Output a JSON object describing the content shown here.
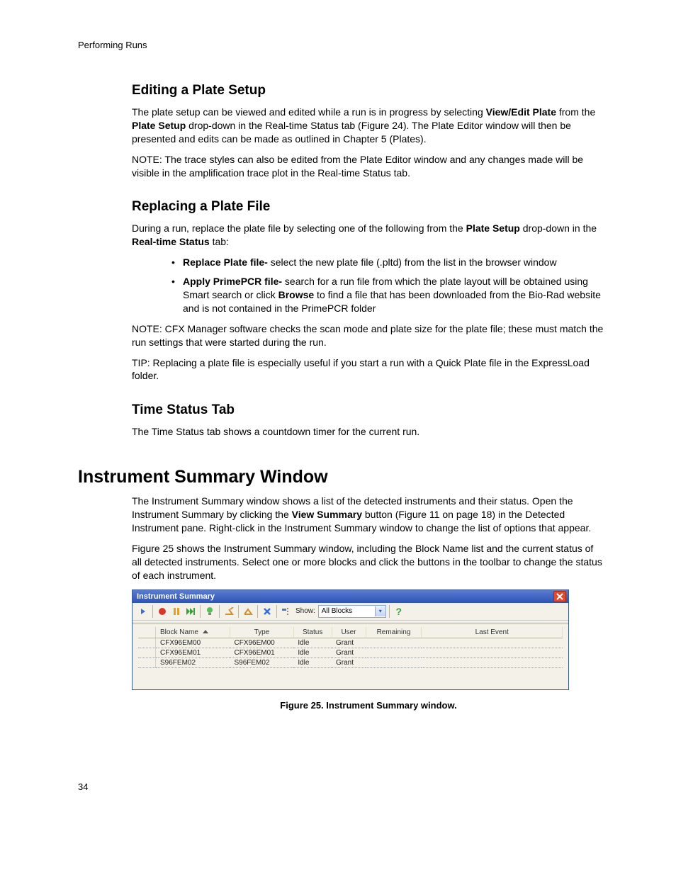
{
  "running_head": "Performing Runs",
  "page_number": "34",
  "sec_editing": {
    "title": "Editing a Plate Setup",
    "p1_a": "The plate setup can be viewed and edited while a run is in progress by selecting ",
    "p1_b": "View/Edit Plate",
    "p1_c": " from the ",
    "p1_d": "Plate Setup",
    "p1_e": " drop-down in the Real-time Status tab (Figure 24). The Plate Editor window will then be presented and edits can be made as outlined in Chapter 5 (Plates).",
    "note": "NOTE: The trace styles can also be edited from the Plate Editor window and any changes made will be visible in the amplification trace plot in the Real-time Status tab."
  },
  "sec_replacing": {
    "title": "Replacing a Plate File",
    "p1_a": "During a run, replace the plate file by selecting one of the following from the ",
    "p1_b": "Plate Setup",
    "p1_c": " drop-down in the ",
    "p1_d": "Real-time Status",
    "p1_e": " tab:",
    "b1_a": "Replace Plate file-",
    "b1_b": " select the new plate file (.pltd) from the list in the browser window",
    "b2_a": "Apply PrimePCR file-",
    "b2_b": " search for a run file from which the plate layout will be obtained using Smart search or click ",
    "b2_c": "Browse",
    "b2_d": " to find a file that has been downloaded from the Bio-Rad website and is not contained in the PrimePCR folder",
    "note": "NOTE: CFX Manager software checks the scan mode and plate size for the plate file; these must match the run settings that were started during the run.",
    "tip": "TIP: Replacing a plate file is especially useful if you start a run with a Quick Plate file in the ExpressLoad folder."
  },
  "sec_time": {
    "title": "Time Status Tab",
    "p1": "The Time Status tab shows a countdown timer for the current run."
  },
  "sec_instr": {
    "title": "Instrument Summary Window",
    "p1_a": "The Instrument Summary window shows a list of the detected instruments and their status. Open the Instrument Summary by clicking the ",
    "p1_b": "View Summary",
    "p1_c": " button (Figure 11 on page 18) in the Detected Instrument pane. Right-click in the Instrument Summary window to change the list of options that appear.",
    "p2": "Figure 25 shows the Instrument Summary window, including the Block Name list and the current status of all detected instruments. Select one or more blocks and click the buttons in the toolbar to change the status of each instrument."
  },
  "figure": {
    "caption": "Figure 25. Instrument Summary window.",
    "window_title": "Instrument Summary",
    "show_label": "Show:",
    "show_value": "All Blocks",
    "columns": [
      "Block Name",
      "Type",
      "Status",
      "User",
      "Remaining",
      "Last Event"
    ],
    "rows": [
      {
        "block": "CFX96EM00",
        "type": "CFX96EM00",
        "status": "Idle",
        "user": "Grant",
        "remaining": "",
        "last": ""
      },
      {
        "block": "CFX96EM01",
        "type": "CFX96EM01",
        "status": "Idle",
        "user": "Grant",
        "remaining": "",
        "last": ""
      },
      {
        "block": "S96FEM02",
        "type": "S96FEM02",
        "status": "Idle",
        "user": "Grant",
        "remaining": "",
        "last": ""
      }
    ]
  }
}
